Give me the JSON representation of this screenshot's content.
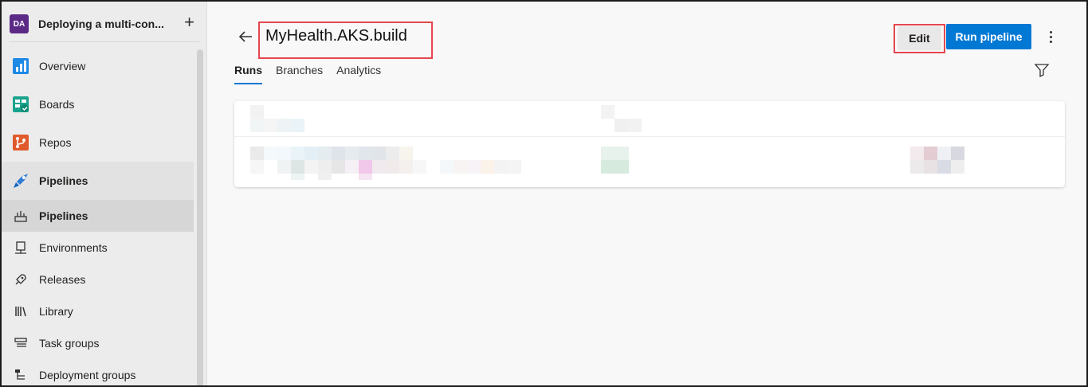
{
  "project": {
    "avatar_initials": "DA",
    "name": "Deploying a multi-con...",
    "avatar_color": "#5b2a86"
  },
  "sidebar": {
    "items": [
      {
        "label": "Overview",
        "icon": "overview-icon"
      },
      {
        "label": "Boards",
        "icon": "boards-icon"
      },
      {
        "label": "Repos",
        "icon": "repos-icon"
      },
      {
        "label": "Pipelines",
        "icon": "pipelines-icon"
      }
    ],
    "sub_items": [
      {
        "label": "Pipelines",
        "icon": "pipelines-sub-icon",
        "active": true
      },
      {
        "label": "Environments",
        "icon": "environments-icon"
      },
      {
        "label": "Releases",
        "icon": "releases-icon"
      },
      {
        "label": "Library",
        "icon": "library-icon"
      },
      {
        "label": "Task groups",
        "icon": "task-groups-icon"
      },
      {
        "label": "Deployment groups",
        "icon": "deployment-groups-icon"
      }
    ]
  },
  "header": {
    "title": "MyHealth.AKS.build",
    "edit_label": "Edit",
    "run_label": "Run pipeline"
  },
  "tabs": [
    {
      "label": "Runs",
      "active": true
    },
    {
      "label": "Branches"
    },
    {
      "label": "Analytics"
    }
  ],
  "colors": {
    "accent": "#0078d4",
    "highlight_box": "#e5474f"
  }
}
